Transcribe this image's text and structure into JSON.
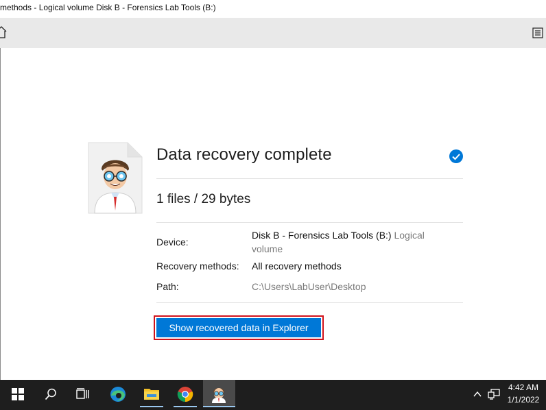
{
  "window": {
    "title": "methods - Logical volume Disk B - Forensics Lab Tools (B:)"
  },
  "result": {
    "heading": "Data recovery complete",
    "summary": "1 files / 29 bytes",
    "device_label": "Device:",
    "device_value_name": "Disk B - Forensics Lab Tools (B:)",
    "device_value_type_1": "Logical",
    "device_value_type_2": "volume",
    "methods_label": "Recovery methods:",
    "methods_value": "All recovery methods",
    "path_label": "Path:",
    "path_value": "C:\\Users\\LabUser\\Desktop",
    "button_label": "Show recovered data in Explorer"
  },
  "taskbar": {
    "time": "4:42 AM",
    "date": "1/1/2022",
    "icons": [
      "windows-start-icon",
      "search-icon",
      "task-view-icon",
      "edge-icon",
      "file-explorer-icon",
      "chrome-icon",
      "recovery-app-icon"
    ]
  },
  "colors": {
    "accent": "#0078d7",
    "highlight_outline": "#d0121b",
    "taskbar": "#1e1e1e"
  }
}
